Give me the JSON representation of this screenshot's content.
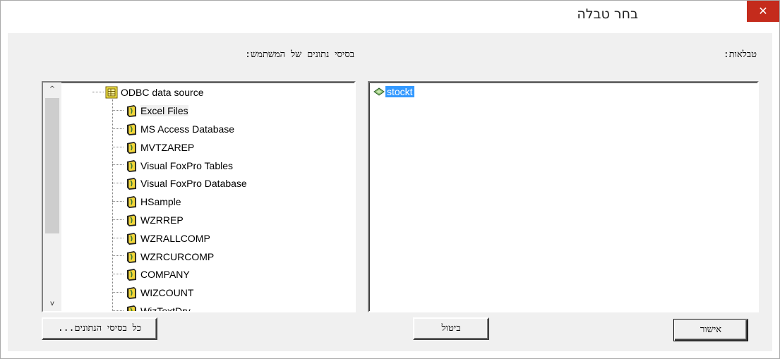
{
  "window": {
    "title": "בחר טבלה",
    "close_glyph": "✕"
  },
  "labels": {
    "tables": "טבלאות:",
    "user_databases": "בסיסי נתונים של המשתמש:"
  },
  "tree": {
    "root": "ODBC data source",
    "items": [
      "Excel Files",
      "MS Access Database",
      "MVTZAREP",
      "Visual FoxPro Tables",
      "Visual FoxPro Database",
      "HSample",
      "WZRREP",
      "WZRALLCOMP",
      "WZRCURCOMP",
      "COMPANY",
      "WIZCOUNT",
      "WizTextDrv"
    ],
    "selected_index": 0
  },
  "tables_list": {
    "items": [
      "stockt"
    ],
    "selected_index": 0
  },
  "scrollbar": {
    "up_glyph": "^",
    "down_glyph": "v"
  },
  "buttons": {
    "all_databases": "כל בסיסי הנתונים...",
    "cancel": "ביטול",
    "ok": "אישור"
  },
  "icons": {
    "root": "odbc-datasource-icon",
    "item": "database-icon",
    "table": "table-icon"
  },
  "colors": {
    "close_button": "#c42b1c",
    "selection": "#3399ff",
    "dialog_bg": "#f0f0f0"
  }
}
